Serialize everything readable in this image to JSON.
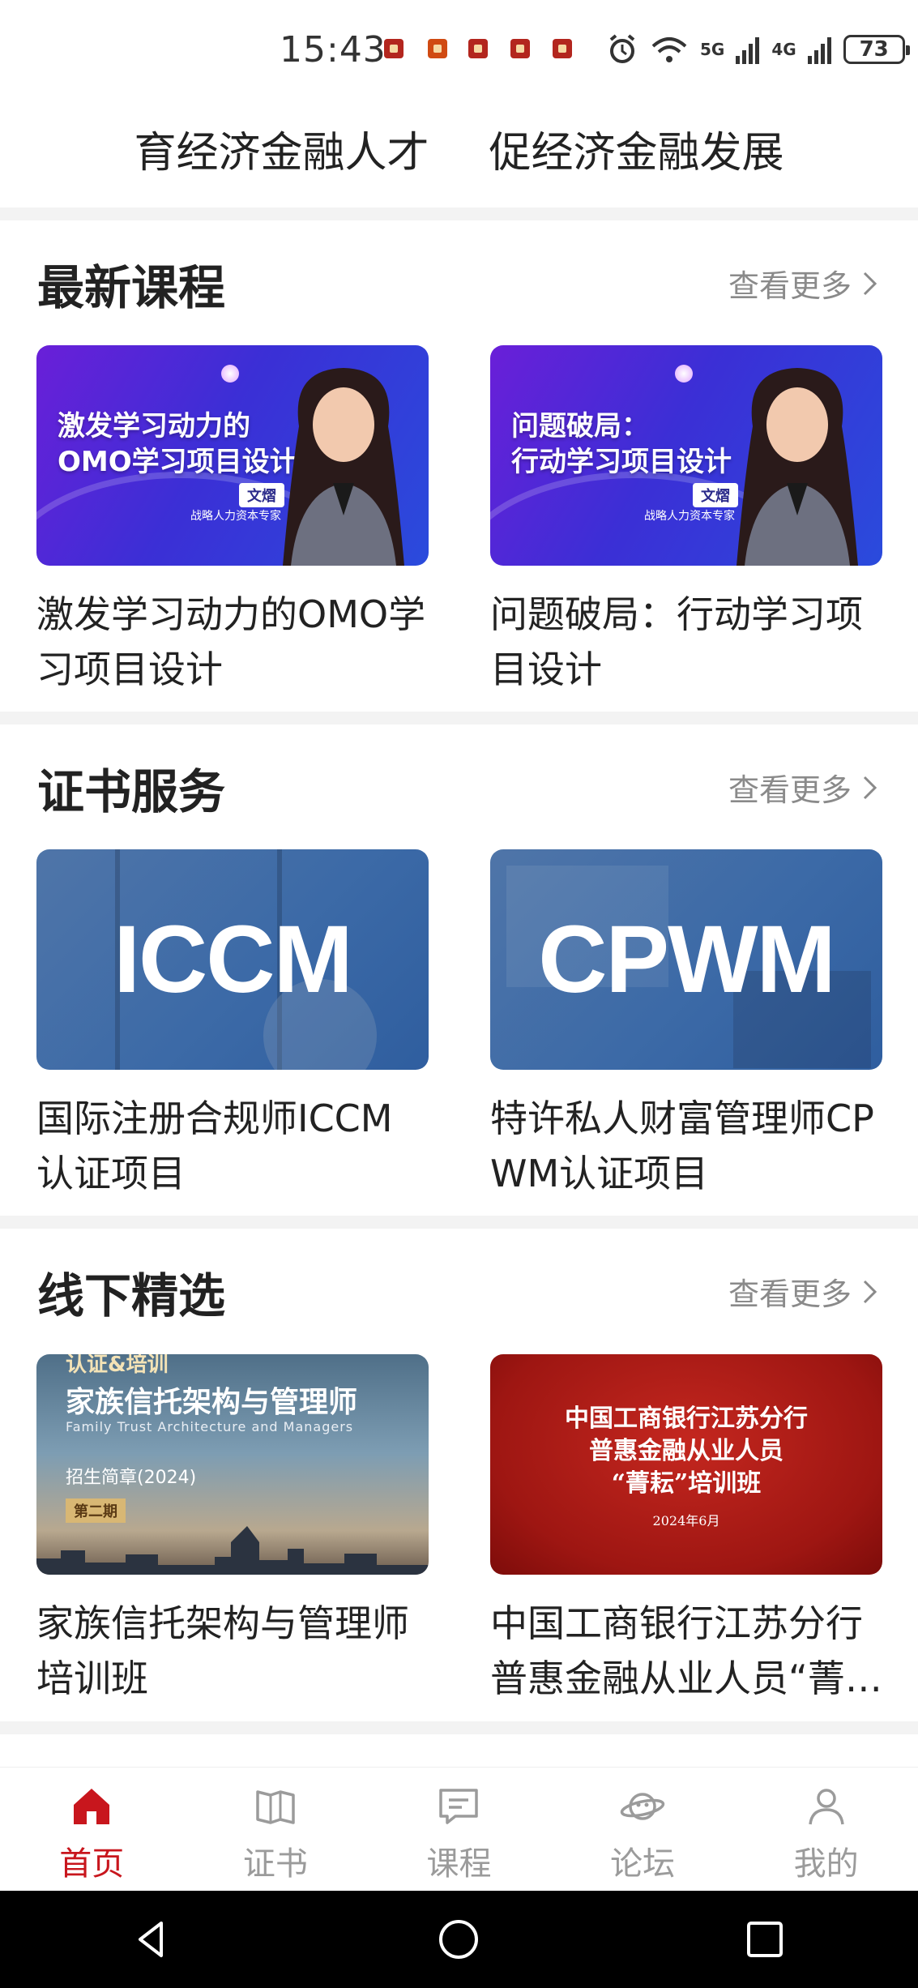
{
  "status_bar": {
    "time": "15:43",
    "network_1": "5G",
    "network_2": "4G",
    "battery": "73"
  },
  "slogan": {
    "left": "育经济金融人才",
    "right": "促经济金融发展"
  },
  "sections": {
    "latest_courses": {
      "title": "最新课程",
      "more": "查看更多",
      "items": [
        {
          "title": "激发学习动力的OMO学习项目设计",
          "banner_line1": "激发学习动力的",
          "banner_line2": "OMO学习项目设计",
          "banner_name": "文熠",
          "banner_role": "战略人力资本专家"
        },
        {
          "title": "问题破局：行动学习项目设计",
          "banner_line1": "问题破局：",
          "banner_line2": "行动学习项目设计",
          "banner_name": "文熠",
          "banner_role": "战略人力资本专家"
        }
      ]
    },
    "certificates": {
      "title": "证书服务",
      "more": "查看更多",
      "items": [
        {
          "title": "国际注册合规师ICCM认证项目",
          "banner_text": "ICCM"
        },
        {
          "title": "特许私人财富管理师CPWM认证项目",
          "banner_text": "CPWM"
        }
      ]
    },
    "offline": {
      "title": "线下精选",
      "more": "查看更多",
      "items": [
        {
          "title": "家族信托架构与管理师培训班",
          "banner_top": "认证&培训",
          "banner_title": "家族信托架构与管理师",
          "banner_sub": "Family Trust Architecture and Managers",
          "banner_year": "招生简章(2024)",
          "banner_tag": "第二期"
        },
        {
          "title": "中国工商银行江苏分行普惠金融从业人员“菁耘”培训班",
          "banner_line1": "中国工商银行江苏分行",
          "banner_line2": "普惠金融从业人员",
          "banner_line3": "“菁耘”培训班",
          "banner_date": "2024年6月"
        }
      ]
    }
  },
  "bottom_nav": {
    "items": [
      {
        "label": "首页",
        "icon": "home-icon",
        "active": true
      },
      {
        "label": "证书",
        "icon": "certificate-icon",
        "active": false
      },
      {
        "label": "课程",
        "icon": "course-icon",
        "active": false
      },
      {
        "label": "论坛",
        "icon": "forum-icon",
        "active": false
      },
      {
        "label": "我的",
        "icon": "profile-icon",
        "active": false
      }
    ]
  },
  "colors": {
    "brand_red": "#c8161d",
    "muted_text": "#8a8a8a",
    "divider": "#f3f3f3"
  }
}
